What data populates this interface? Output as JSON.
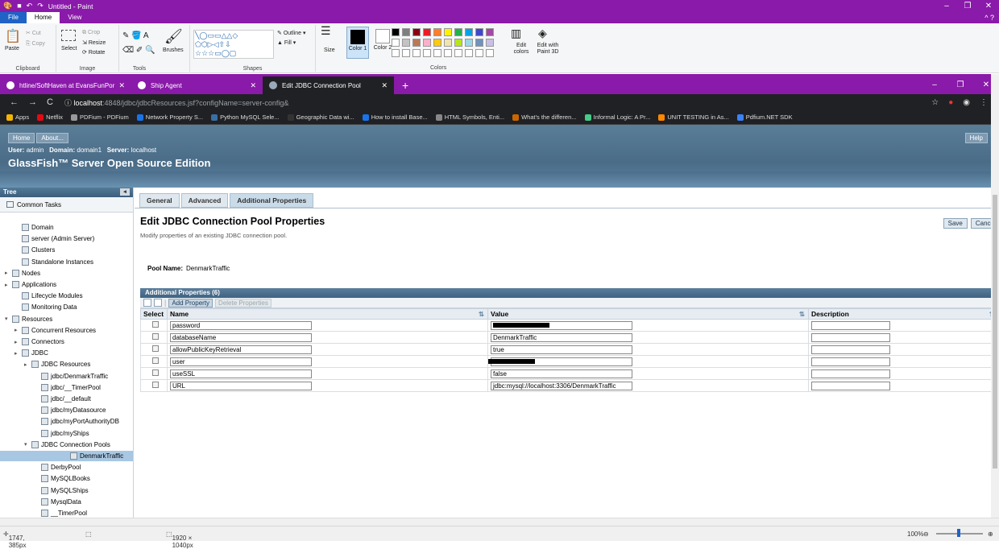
{
  "paint": {
    "title": "Untitled - Paint",
    "tabs": [
      "File",
      "Home",
      "View"
    ],
    "clipboard": {
      "paste": "Paste",
      "cut": "Cut",
      "copy": "Copy",
      "label": "Clipboard"
    },
    "image": {
      "crop": "Crop",
      "resize": "Resize",
      "rotate": "Rotate",
      "select": "Select",
      "label": "Image"
    },
    "tools": {
      "label": "Tools"
    },
    "brushes": "Brushes",
    "shapes": {
      "outline": "Outline",
      "fill": "Fill",
      "label": "Shapes"
    },
    "size": "Size",
    "color1": "Color 1",
    "color2": "Color 2",
    "colors_label": "Colors",
    "edit_colors": "Edit colors",
    "paint3d": "Edit with Paint 3D",
    "palette": [
      "#000000",
      "#7f7f7f",
      "#880015",
      "#ed1c24",
      "#ff7f27",
      "#fff200",
      "#22b14c",
      "#00a2e8",
      "#3f48cc",
      "#a349a4",
      "#ffffff",
      "#c3c3c3",
      "#b97a57",
      "#ffaec9",
      "#ffc90e",
      "#efe4b0",
      "#b5e61d",
      "#99d9ea",
      "#7092be",
      "#c8bfe7"
    ],
    "status": {
      "coords": "1747, 385px",
      "dims": "1920 × 1040px",
      "zoom": "100%"
    }
  },
  "browser": {
    "tabs": [
      {
        "label": "htline/SoftHaven at EvansFunPor"
      },
      {
        "label": "Ship Agent"
      },
      {
        "label": "Edit JDBC Connection Pool"
      }
    ],
    "url_host": "localhost",
    "url_rest": ":4848/jdbc/jdbcResources.jsf?configName=server-config&",
    "bookmarks": [
      "Apps",
      "Netflix",
      "PDFium - PDFium",
      "Network Property S...",
      "Python MySQL Sele...",
      "Geographic Data wi...",
      "How to install Base...",
      "HTML Symbols, Enti...",
      "What's the differen...",
      "Informal Logic: A Pr...",
      "UNIT TESTING in As...",
      "Pdfium.NET SDK"
    ]
  },
  "gf": {
    "home": "Home",
    "about": "About...",
    "help": "Help",
    "user_label": "User:",
    "user": "admin",
    "domain_label": "Domain:",
    "domain": "domain1",
    "server_label": "Server:",
    "server": "localhost",
    "product": "GlassFish™ Server Open Source Edition",
    "tree": {
      "title": "Tree",
      "common_tasks": "Common Tasks",
      "nodes": [
        "Domain",
        "server (Admin Server)",
        "Clusters",
        "Standalone Instances",
        "Nodes",
        "Applications",
        "Lifecycle Modules",
        "Monitoring Data",
        "Resources",
        "Concurrent Resources",
        "Connectors",
        "JDBC",
        "JDBC Resources",
        "jdbc/DenmarkTraffic",
        "jdbc/__TimerPool",
        "jdbc/__default",
        "jdbc/myDatasource",
        "jdbc/myPortAuthorityDB",
        "jdbc/myShips",
        "JDBC Connection Pools",
        "DenmarkTraffic",
        "DerbyPool",
        "MySQLBooks",
        "MySQLShips",
        "MysqlData",
        "__TimerPool"
      ]
    },
    "tabs": [
      "General",
      "Advanced",
      "Additional Properties"
    ],
    "heading": "Edit JDBC Connection Pool Properties",
    "subheading": "Modify properties of an existing JDBC connection pool.",
    "save": "Save",
    "cancel": "Cance",
    "pool_label": "Pool Name:",
    "pool_name": "DenmarkTraffic",
    "table": {
      "caption": "Additional Properties (6)",
      "add": "Add Property",
      "delete": "Delete Properties",
      "headers": [
        "Select",
        "Name",
        "Value",
        "Description"
      ],
      "rows": [
        {
          "name": "password",
          "value": "",
          "redacted": true
        },
        {
          "name": "databaseName",
          "value": "DenmarkTraffic"
        },
        {
          "name": "allowPublicKeyRetrieval",
          "value": "true"
        },
        {
          "name": "user",
          "value": "",
          "redacted": true
        },
        {
          "name": "useSSL",
          "value": "false"
        },
        {
          "name": "URL",
          "value": "jdbc:mysql://localhost:3306/DenmarkTraffic"
        }
      ]
    }
  }
}
